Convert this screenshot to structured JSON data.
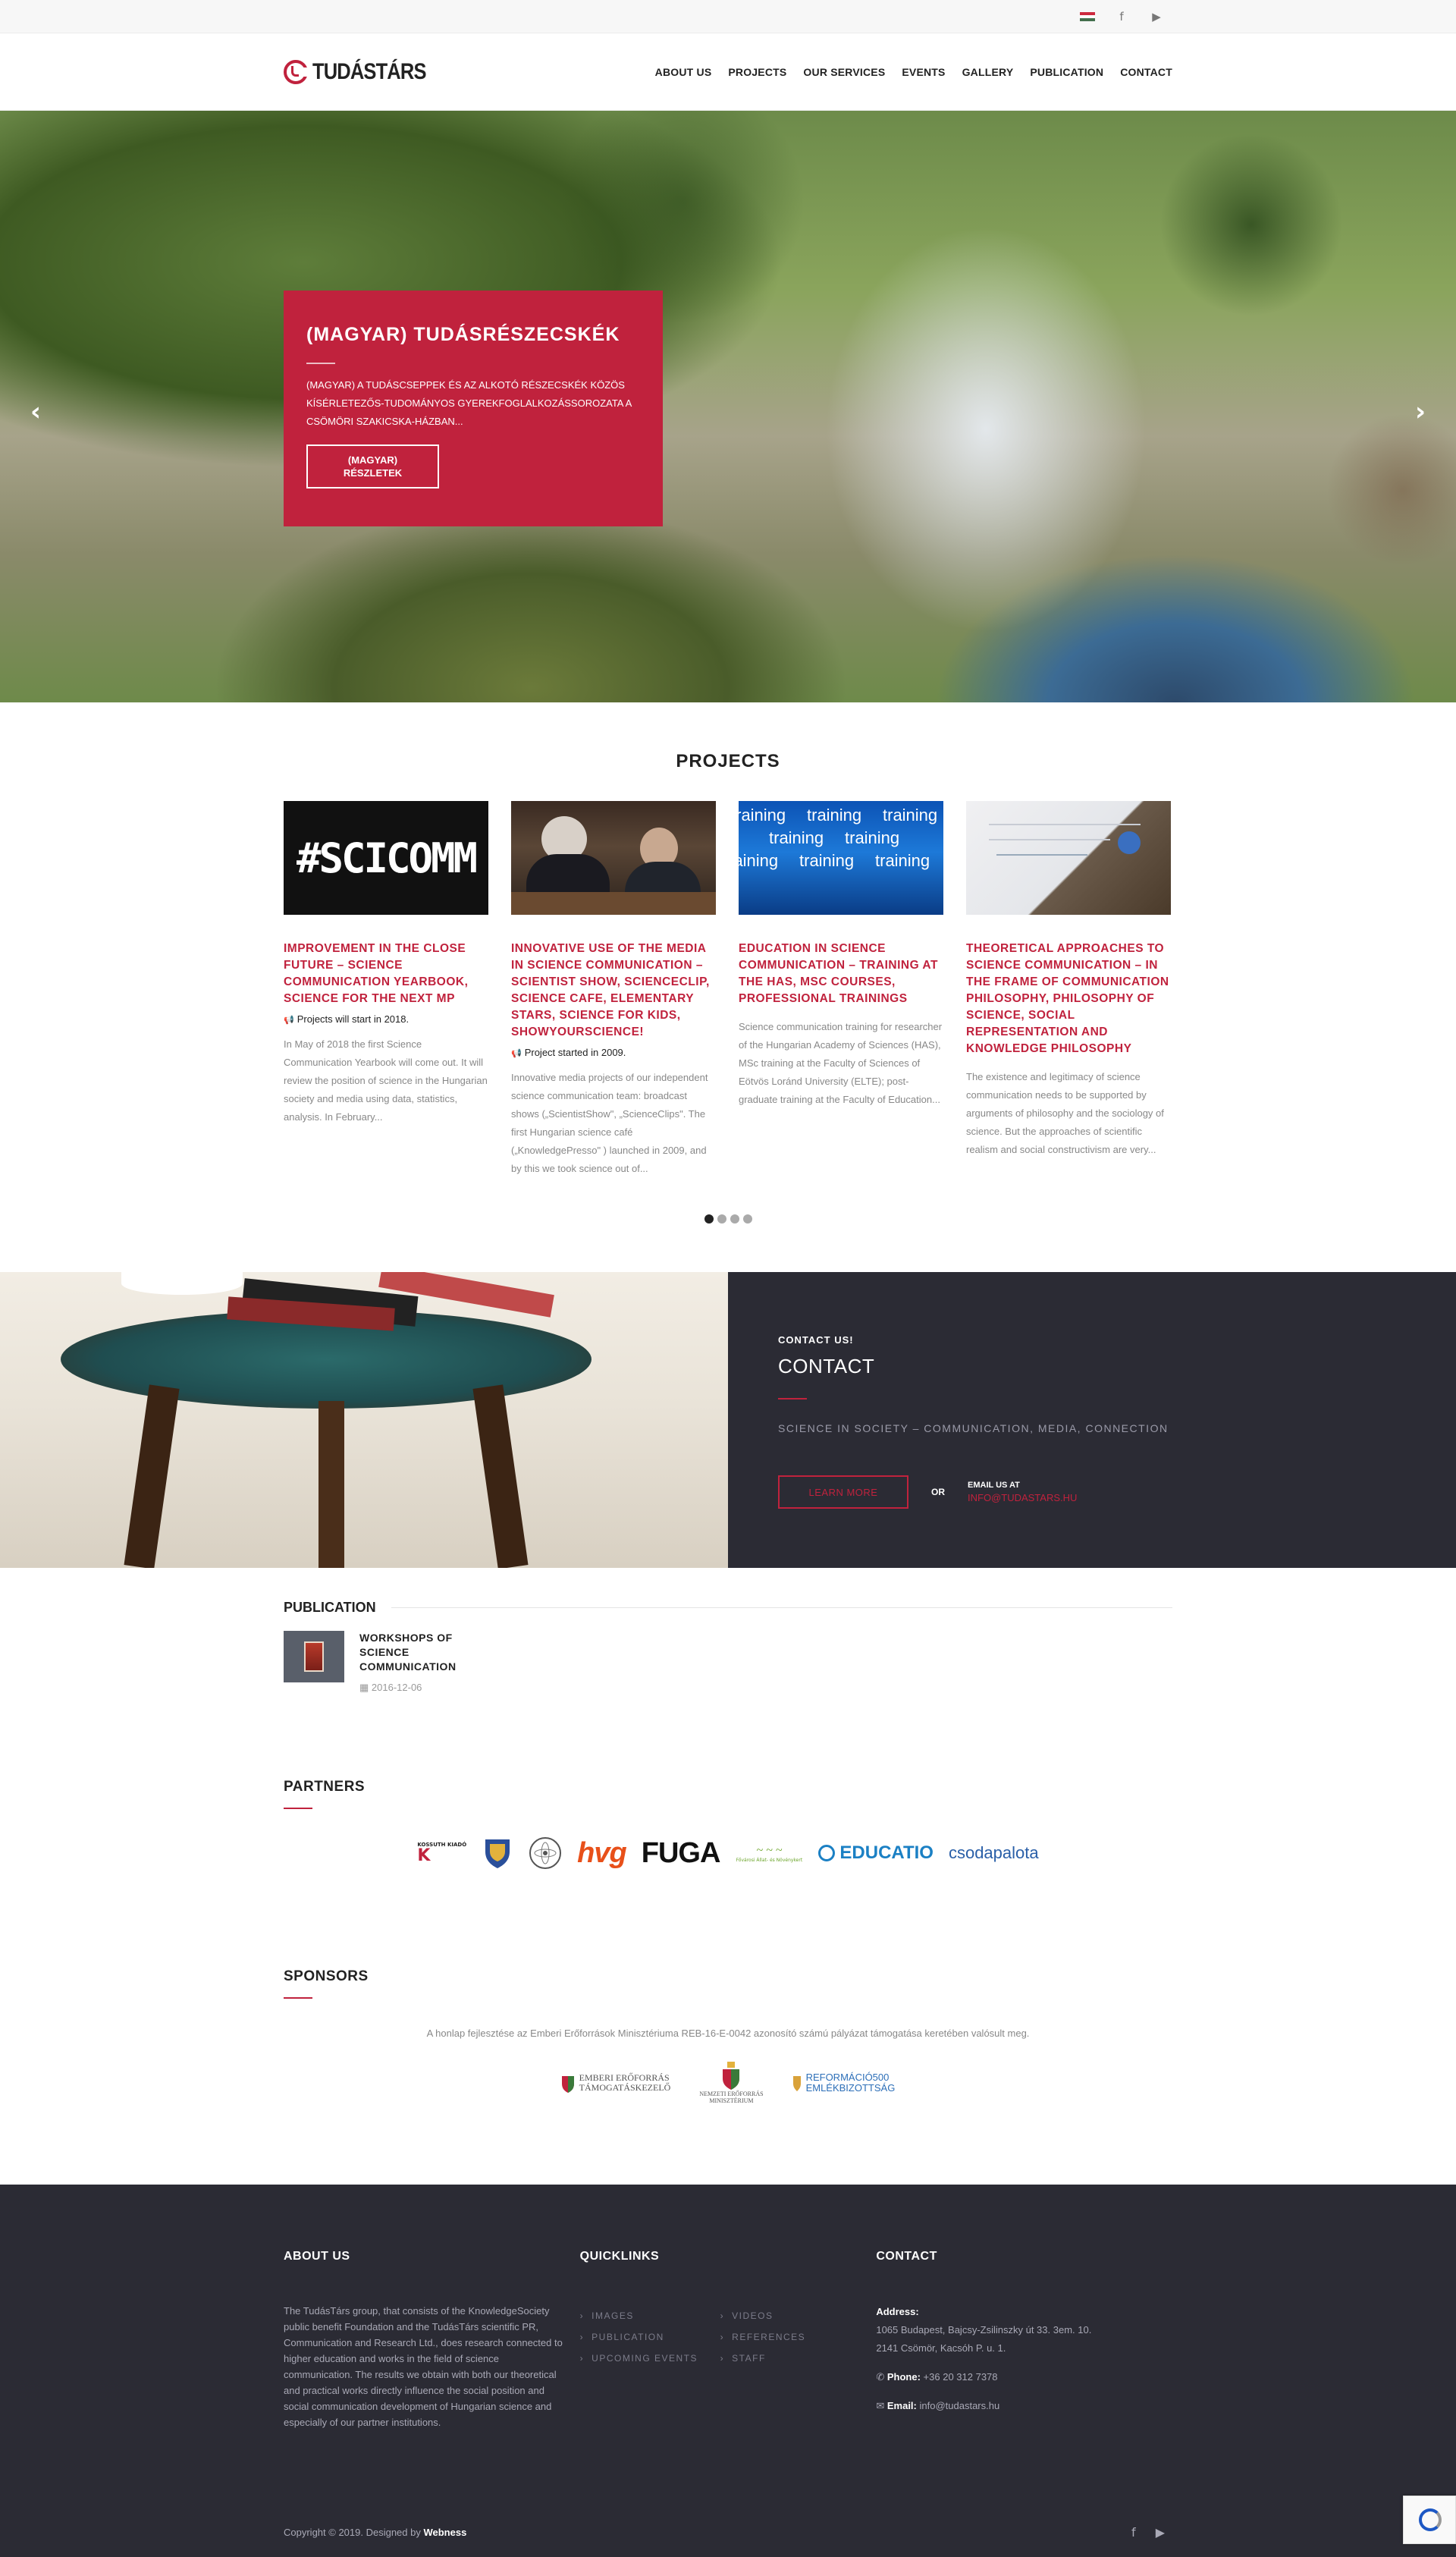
{
  "topbar": {
    "flag_colors": [
      "#cd2a3e",
      "#ffffff",
      "#436f4d"
    ],
    "icons": [
      "facebook-icon",
      "youtube-icon"
    ]
  },
  "header": {
    "logo_text": "TUDÁSTÁRS",
    "nav": [
      "ABOUT US",
      "PROJECTS",
      "OUR SERVICES",
      "EVENTS",
      "GALLERY",
      "PUBLICATION",
      "CONTACT"
    ]
  },
  "hero": {
    "title": "(MAGYAR) TUDÁSRÉSZECSKÉK",
    "text": "(MAGYAR) A TUDÁSCSEPPEK ÉS AZ ALKOTÓ RÉSZECSKÉK KÖZÖS KÍSÉRLETEZŐS-TUDOMÁNYOS GYEREKFOGLALKOZÁSSOROZATA A CSÖMÖRI SZAKICSKA-HÁZBAN...",
    "button": "(MAGYAR)\nRÉSZLETEK",
    "prev": "‹",
    "next": "›"
  },
  "projects": {
    "title": "PROJECTS",
    "items": [
      {
        "image_text": "#SCICOMM",
        "title": "IMPROVEMENT IN THE CLOSE FUTURE – SCIENCE COMMUNICATION YEARBOOK, SCIENCE FOR THE NEXT MP",
        "meta": "Projects will start in 2018.",
        "desc": "In May of 2018 the first Science Communication Yearbook will come out. It will review the position of science in the Hungarian society and media using data, statistics, analysis. In February..."
      },
      {
        "title": "INNOVATIVE USE OF THE MEDIA IN SCIENCE COMMUNICATION – SCIENTIST SHOW, SCIENCECLIP, SCIENCE CAFE, ELEMENTARY STARS, SCIENCE FOR KIDS, SHOWYOURSCIENCE!",
        "meta": "Project started in 2009.",
        "desc": "Innovative media projects of our independent science communication team: broadcast shows („ScientistShow\", „ScienceClips\". The first Hungarian science café („KnowledgePresso\" ) launched in 2009, and by this we took science out of..."
      },
      {
        "image_text": "training",
        "title": "EDUCATION IN SCIENCE COMMUNICATION – TRAINING AT THE HAS, MSC COURSES, PROFESSIONAL TRAININGS",
        "desc": "Science communication training for researcher of the Hungarian Academy of Sciences (HAS), MSc training at the Faculty of Sciences of Eötvös Loránd University (ELTE); post-graduate training at the Faculty of Education..."
      },
      {
        "title": "THEORETICAL APPROACHES TO SCIENCE COMMUNICATION – IN THE FRAME OF COMMUNICATION PHILOSOPHY, PHILOSOPHY OF SCIENCE, SOCIAL REPRESENTATION AND KNOWLEDGE PHILOSOPHY",
        "desc": "The existence and legitimacy of science communication needs to be supported by arguments of philosophy and the sociology of science. But the approaches of scientific realism and social constructivism are very..."
      }
    ]
  },
  "contact_band": {
    "small": "CONTACT US!",
    "title": "CONTACT",
    "tagline": "SCIENCE IN SOCIETY – COMMUNICATION, MEDIA, CONNECTION",
    "button": "LEARN MORE",
    "or": "OR",
    "email_label": "EMAIL US AT",
    "email": "INFO@TUDASTARS.HU"
  },
  "publication": {
    "title": "PUBLICATION",
    "item_title": "WORKSHOPS OF SCIENCE COMMUNICATION",
    "item_date": "2016-12-06"
  },
  "partners": {
    "title": "PARTNERS",
    "logos": [
      "KOSSUTH KIADÓ",
      "hvg",
      "FUGA",
      "Fővárosi Állat- és Növénykert",
      "EDUCATIO",
      "csodapalota"
    ]
  },
  "sponsors": {
    "title": "SPONSORS",
    "note": "A honlap fejlesztése az Emberi Erőforrások Minisztériuma REB-16-E-0042 azonosító számú pályázat támogatása keretében valósult meg.",
    "logo1": "EMBERI ERŐFORRÁS\nTÁMOGATÁSKEZELŐ",
    "logo2": "NEMZETI ERŐFORRÁS\nMINISZTÉRIUM",
    "logo3": "REFORMÁCIÓ500\nEMLÉKBIZOTTSÁG"
  },
  "footer": {
    "about_title": "ABOUT US",
    "about_text": "The TudásTárs group, that consists of the KnowledgeSociety public benefit Foundation and the TudásTárs scientific PR, Communication and Research Ltd., does research connected to higher education and works in the field of science communication. The results we obtain with both our theoretical and practical works directly influence the social position and social communication development of Hungarian science and especially of our partner institutions.",
    "quicklinks_title": "QUICKLINKS",
    "quicklinks": [
      "IMAGES",
      "VIDEOS",
      "PUBLICATION",
      "REFERENCES",
      "UPCOMING EVENTS",
      "STAFF"
    ],
    "contact_title": "CONTACT",
    "address_label": "Address:",
    "address1": "1065 Budapest, Bajcsy-Zsilinszky út 33. 3em. 10.",
    "address2": "2141 Csömör, Kacsóh P. u. 1.",
    "phone_label": "Phone:",
    "phone": "+36 20 312 7378",
    "email_label": "Email:",
    "email": "info@tudastars.hu",
    "copyright": "Copyright © 2019. Designed by ",
    "designer": "Webness"
  },
  "colors": {
    "accent": "#c0223d",
    "dark": "#2b2b34"
  }
}
